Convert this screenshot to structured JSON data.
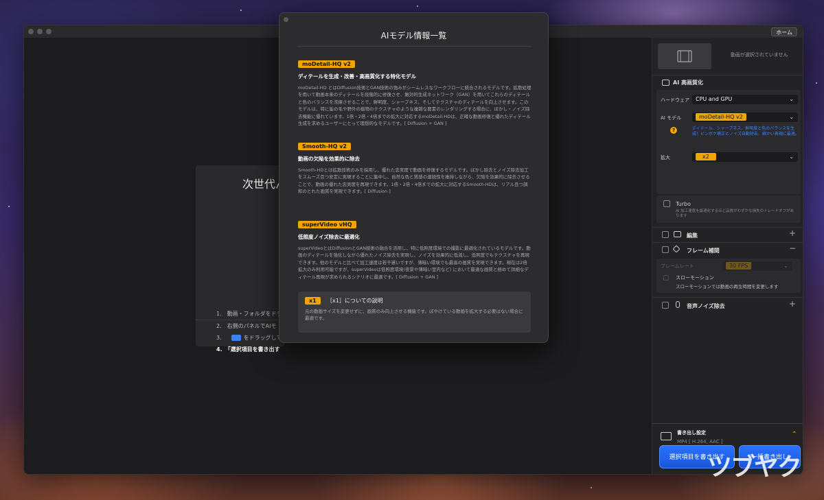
{
  "window": {
    "home_label": "ホーム"
  },
  "workspace": {
    "welcome_title": "次世代ん",
    "steps": [
      "1.　動画・フォルダをドラ",
      "2.　右側のパネルでAIモ",
      "3.",
      "4.　「選択項目を書き出す"
    ],
    "step3_suffix": "をドラッグして"
  },
  "modal": {
    "title": "AIモデル情報一覧",
    "models": [
      {
        "name": "moDetail-HQ  v2",
        "heading": "ディテールを生成・改善・高画質化する特化モデル",
        "body": "moDetail-HD とはDiffusion技術とGAN技術の強みがシームレスなワークフローに統合されるモデルです。拡散処理を用いて動画本来のディテールを段階的に修復させ、敵対的生成ネットワーク（GAN）を用いてこれらのディテールと色のバランスを洗練させることで、鮮明度、シャープネス、そしてテクスチャのディテールを向上させます。このモデルは、特に髪の毛や野外の植物のテクスチャのような複雑な要素のレンダリングする場合に、ぼかし・ノイズ除去機能に優れています。1倍・2倍・4倍までの拡大に対応するmoDetail-HDは、正確な動画修復と優れたディテール生成を求めるユーザーにとって理想的なモデルです。[ Diffusion + GAN ]"
      },
      {
        "name": "Smooth-HQ  v2",
        "heading": "動画の欠陥を効果的に除去",
        "body": "Smooth-HDとは拡散技術のみを採用し、優れた忠実度で動画を修復するモデルです。ぼかし除去とノイズ除去加工をスムーズ且つ安定に実現することに集中し、自然な色と質感の連続性を維持しながら、欠陥を効果的に除去させることで、動画の優れた忠実度を再現できます。1倍・2倍・4倍までの拡大に対応するSmooth-HDは、リアル且つ調和のとれた画質を実現できます。[ Diffusion ]"
      },
      {
        "name": "superVideo vHQ",
        "heading": "低照度ノイズ除去に最適化",
        "body": "superVideoとはDiffusionとGAN技術の融合を活用し、特に低照度環境での撮影に最適化されているモデルです。動画のディテールを強化しながら優れたノイズ除去を実現し、ノイズを効果的に低減し、低照度でもテクスチャを再現できます。他のモデルと比べて加工速度は若干遅いですが、薄暗い環境でも最高の画質を実現できます。現在は2倍拡大のみ利用可能ですが、superVideoは低照度環境(夜景や薄暗い室内など) において最適な画質と極めて詳細なディテール再現が求められるシナリオに最適です。[ Diffusion + GAN ]"
      }
    ],
    "info": {
      "badge": "x1",
      "title": "［x1］についての説明",
      "text": "元の動画サイズを変更せずに、画質のみ向上させる機能です。ぼやけている動画を拡大する必要はない場合に最適です。"
    }
  },
  "right_panel": {
    "no_video": "動画が選択されていません",
    "ai_enhance_title": "AI 高画質化",
    "hardware_label": "ハードウェア",
    "hardware_value": "CPU and GPU",
    "ai_model_label": "AI モデル",
    "ai_model_value": "moDetail-HQ  v2",
    "ai_model_desc": "ディテール、シャープネス、鮮明度と色のバランスを生成！ピンボケ補正とノイズ自動除去、細かい表現に最適。",
    "scale_label": "拡大",
    "scale_value": "x2",
    "turbo_label": "Turbo",
    "turbo_desc": "AI 加工速度を最適化するほど品質がわずかな損失のトレードオフがあります",
    "edit_label": "編集",
    "frame_interp_label": "フレーム補間",
    "frame_rate_label": "フレームレート",
    "frame_rate_value": "30 FPS",
    "slow_motion_label": "スローモーション",
    "slow_motion_desc": "スローモーションでは動画の再生時間を変更します",
    "noise_reduction_label": "音声ノイズ除去",
    "export_settings_label": "書き出し設定",
    "export_format": "MP4 [ H.264, AAC ]",
    "export_selected_label": "選択項目を書き出す",
    "export_all_label": "一括書き出し"
  },
  "watermark": "ツブヤク"
}
